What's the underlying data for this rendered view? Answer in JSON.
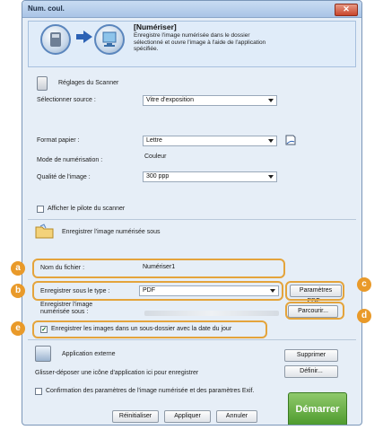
{
  "window": {
    "title": "Num. coul.",
    "close_glyph": "✕"
  },
  "header": {
    "title": "[Numériser]",
    "description": "Enregistre l'image numérisée dans le dossier sélectionné et ouvre l'image à l'aide de l'application spécifiée."
  },
  "scanner": {
    "section_label": "Réglages du Scanner",
    "source_label": "Sélectionner source :",
    "source_value": "Vitre d'exposition",
    "paper_label": "Format papier :",
    "paper_value": "Lettre",
    "mode_label": "Mode de numérisation :",
    "mode_value": "Couleur",
    "quality_label": "Qualité de l'image :",
    "quality_value": "300 ppp",
    "driver_checkbox_label": "Afficher le pilote du scanner",
    "driver_checked": false
  },
  "save": {
    "section_label": "Enregistrer l'image numérisée sous",
    "filename_label": "Nom du fichier :",
    "filename_value": "Numériser1",
    "type_label": "Enregistrer sous le type :",
    "type_value": "PDF",
    "pdf_settings_button": "Paramètres PDF...",
    "location_label": "Enregistrer l'image numérisée sous :",
    "browse_button": "Parcourir...",
    "subfolder_label": "Enregistrer les images dans un sous-dossier avec la date du jour",
    "subfolder_checked": true,
    "subfolder_check_glyph": "✓"
  },
  "external_app": {
    "section_label": "Application externe",
    "drop_hint": "Glisser-déposer une icône d'application ici pour enregistrer",
    "delete_button": "Supprimer",
    "define_button": "Définir..."
  },
  "footer": {
    "confirm_label": "Confirmation des paramètres de l'image numérisée et des paramètres Exif.",
    "confirm_checked": false,
    "reset_button": "Réinitialiser",
    "apply_button": "Appliquer",
    "cancel_button": "Annuler",
    "start_button": "Démarrer"
  },
  "callouts": {
    "a": "a",
    "b": "b",
    "c": "c",
    "d": "d",
    "e": "e"
  },
  "colors": {
    "callout": "#e99a2a",
    "start_button": "#4d9a2d",
    "title_bar": "#a9c4e6"
  }
}
